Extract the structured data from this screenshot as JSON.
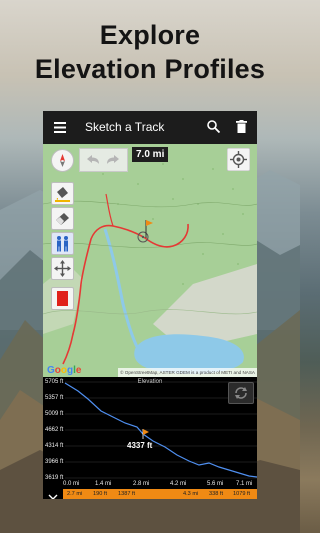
{
  "promo": {
    "line1": "Explore",
    "line2": "Elevation Profiles"
  },
  "appbar": {
    "title": "Sketch a Track",
    "menu_icon": "hamburger-menu-icon",
    "search_icon": "search-icon",
    "delete_icon": "trash-icon"
  },
  "map": {
    "distance": "7.0 mi",
    "attribution": "© OpenStreetMap, ASTER GDEM is a product of METI and NASA",
    "google": "Google",
    "tools": [
      "compass-icon",
      "paint-bucket-icon",
      "eraser-icon",
      "hikers-icon",
      "move-arrows-icon",
      "color-swatch-icon"
    ],
    "colors": {
      "track": "#e53935",
      "flag": "#f08a14",
      "water": "#8ec9e8",
      "forest": "#a9d29b"
    }
  },
  "elevation": {
    "title": "Elevation",
    "y_ticks": [
      "5705 ft",
      "5357 ft",
      "5009 ft",
      "4662 ft",
      "4314 ft",
      "3966 ft",
      "3619 ft"
    ],
    "x_ticks": [
      "0.0 mi",
      "1.4 mi",
      "2.8 mi",
      "4.2 mi",
      "5.6 mi",
      "7.1 mi"
    ],
    "marker_label": "4337 ft",
    "stats": {
      "left_dist": "2.7 mi",
      "left_up": "190 ft",
      "left_down": "1387 ft",
      "right_dist": "4.3 mi",
      "right_up": "338 ft",
      "right_down": "1079 ft"
    }
  }
}
